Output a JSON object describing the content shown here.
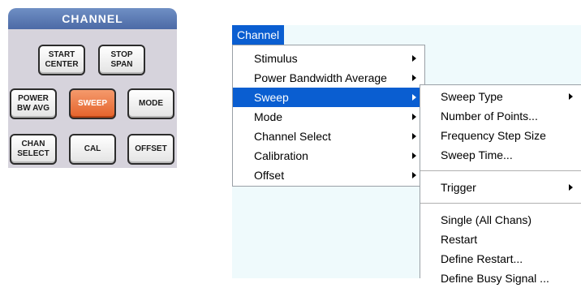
{
  "panel": {
    "title": "CHANNEL",
    "keys": [
      {
        "label": "START\nCENTER",
        "active": false
      },
      {
        "label": "STOP\nSPAN",
        "active": false
      },
      {
        "label": "POWER\nBW AVG",
        "active": false
      },
      {
        "label": "SWEEP",
        "active": true
      },
      {
        "label": "MODE",
        "active": false
      },
      {
        "label": "CHAN\nSELECT",
        "active": false
      },
      {
        "label": "CAL",
        "active": false
      },
      {
        "label": "OFFSET",
        "active": false
      }
    ]
  },
  "menubar": {
    "label": "Channel"
  },
  "main_menu": {
    "items": [
      {
        "label": "Stimulus",
        "submenu": true
      },
      {
        "label": "Power Bandwidth Average",
        "submenu": true
      },
      {
        "label": "Sweep",
        "submenu": true,
        "highlighted": true
      },
      {
        "label": "Mode",
        "submenu": true
      },
      {
        "label": "Channel Select",
        "submenu": true
      },
      {
        "label": "Calibration",
        "submenu": true
      },
      {
        "label": "Offset",
        "submenu": true
      }
    ]
  },
  "sweep_menu": {
    "items": [
      {
        "label": "Sweep Type",
        "submenu": true
      },
      {
        "label": "Number of Points..."
      },
      {
        "label": "Frequency Step Size"
      },
      {
        "label": "Sweep Time..."
      },
      {
        "label": "Trigger",
        "submenu": true
      },
      {
        "label": "Single (All Chans)"
      },
      {
        "label": "Restart"
      },
      {
        "label": "Define Restart..."
      },
      {
        "label": "Define Busy Signal ..."
      }
    ]
  },
  "colors": {
    "highlight": "#0a5ed1",
    "active_key": "#e4622a",
    "panel_header": "#4c6aa6"
  }
}
